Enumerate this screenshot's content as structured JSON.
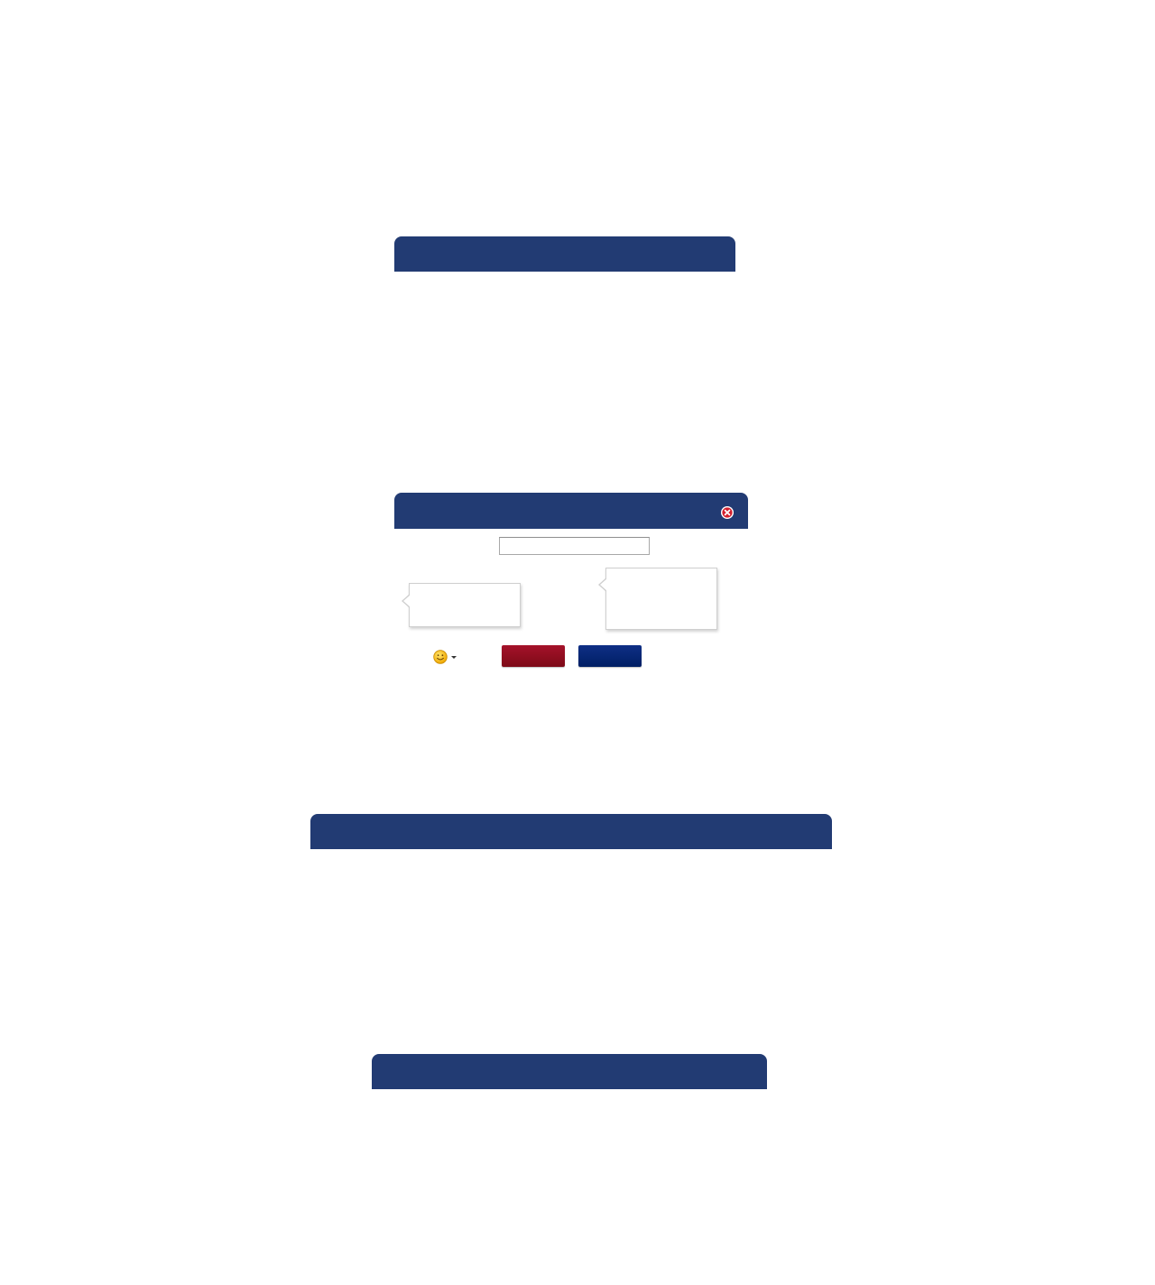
{
  "dialogs": [
    {
      "title": ""
    },
    {
      "title": ""
    },
    {
      "title": ""
    },
    {
      "title": ""
    }
  ],
  "form": {
    "input_value": "",
    "input_placeholder": "",
    "bubble_left_text": "",
    "bubble_right_text": "",
    "red_button_label": "",
    "blue_button_label": ""
  },
  "icons": {
    "close": "close-icon",
    "emoji": "smiley-icon",
    "dropdown": "chevron-down-icon"
  },
  "colors": {
    "header": "#223b73",
    "close_icon": "#d3202e",
    "red_button": "#8e0e1f",
    "blue_button": "#002470",
    "smiley": "#f4b100"
  }
}
